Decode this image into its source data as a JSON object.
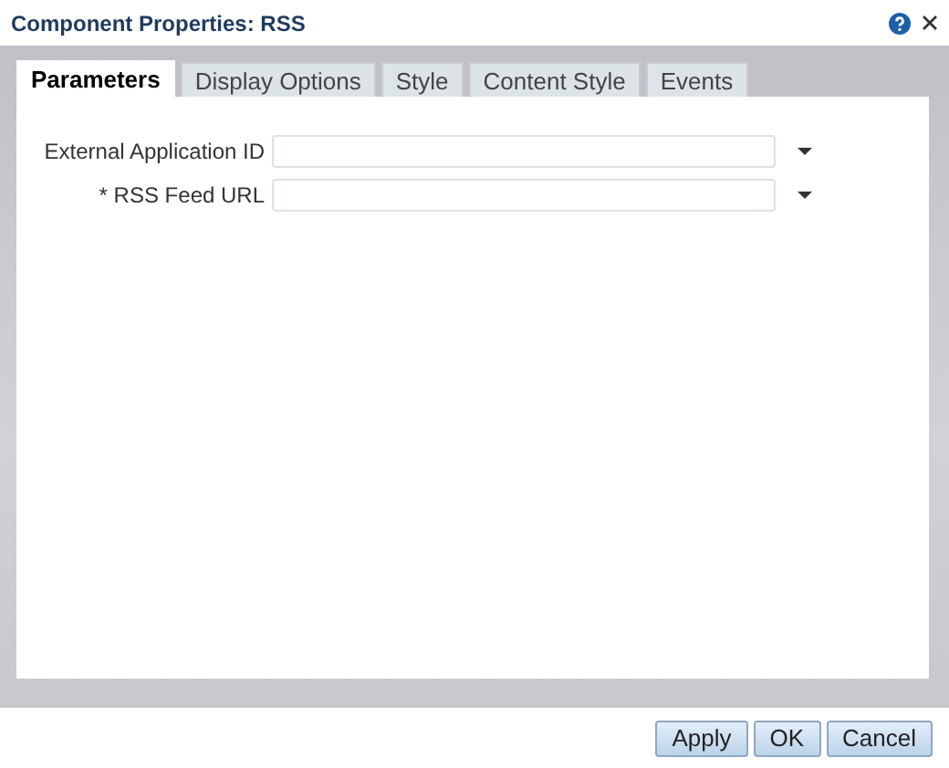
{
  "window": {
    "title": "Component Properties: RSS"
  },
  "tabs": [
    {
      "label": "Parameters",
      "selected": true
    },
    {
      "label": "Display Options",
      "selected": false
    },
    {
      "label": "Style",
      "selected": false
    },
    {
      "label": "Content Style",
      "selected": false
    },
    {
      "label": "Events",
      "selected": false
    }
  ],
  "fields": [
    {
      "label": "External Application ID",
      "required": false
    },
    {
      "label": "RSS Feed URL",
      "required": true
    }
  ],
  "required_mark": "*",
  "buttons": [
    "Apply",
    "OK",
    "Cancel"
  ]
}
